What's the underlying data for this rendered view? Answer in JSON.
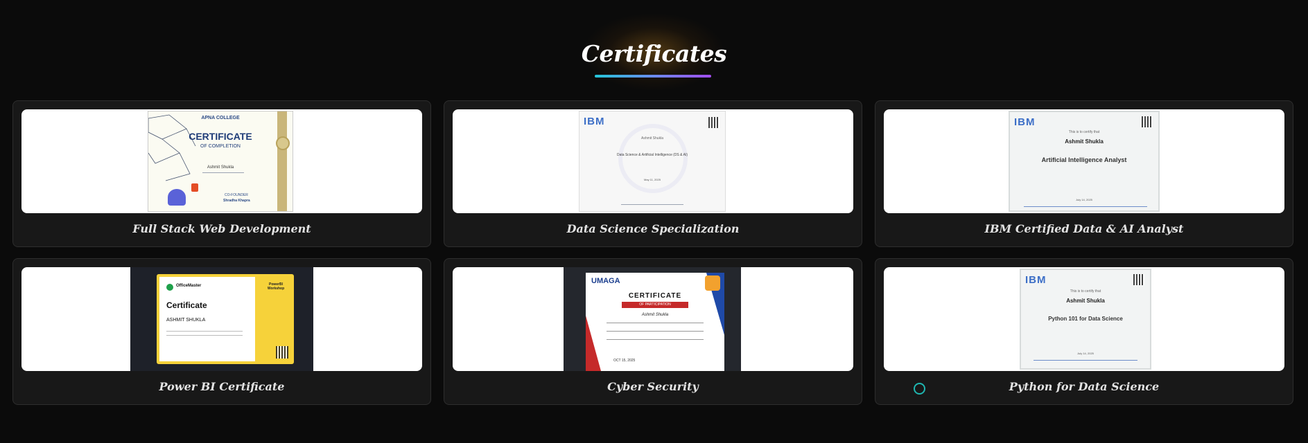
{
  "section": {
    "title": "Certificates"
  },
  "cards": [
    {
      "caption": "Full Stack Web Development",
      "cert": {
        "org": "APNA COLLEGE",
        "heading": "CERTIFICATE",
        "sub": "OF COMPLETION",
        "name": "Ashmit Shukla",
        "role": "CO-FOUNDER",
        "signer": "Shradha Khapra"
      }
    },
    {
      "caption": "Data Science Specialization",
      "cert": {
        "org": "IBM",
        "name": "Ashmit Shukla",
        "course": "Data Science & Artificial Intelligence (DS & AI)",
        "date": "May 11, 2025"
      }
    },
    {
      "caption": "IBM Certified Data & AI Analyst",
      "cert": {
        "org": "IBM",
        "intro": "This is to certify that",
        "name": "Ashmit Shukla",
        "course": "Artificial Intelligence Analyst",
        "date": "July 14, 2025"
      }
    },
    {
      "caption": "Power BI Certificate",
      "cert": {
        "org": "OfficeMaster",
        "heading": "Certificate",
        "name": "ASHMIT SHUKLA",
        "badge": "PowerBI Workshop"
      }
    },
    {
      "caption": "Cyber Security",
      "cert": {
        "org": "UMAGA",
        "heading": "CERTIFICATE",
        "sub": "OF PARTICIPATION",
        "name": "Ashmit Shukla",
        "date": "OCT 15, 2025"
      }
    },
    {
      "caption": "Python for Data Science",
      "cert": {
        "org": "IBM",
        "intro": "This is to certify that",
        "name": "Ashmit Shukla",
        "course": "Python 101 for Data Science",
        "date": "July 14, 2025"
      }
    }
  ]
}
